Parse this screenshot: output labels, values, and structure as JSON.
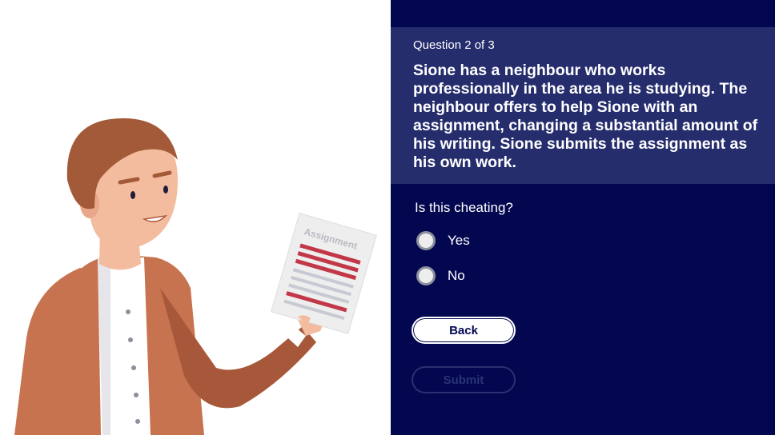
{
  "illustration": {
    "document_label": "Assignment",
    "colors": {
      "skin": "#f3bc9f",
      "hair": "#a25a38",
      "jacket": "#c8734f",
      "shirt": "#ffffff",
      "paper_lines_red": "#c23848",
      "paper_lines_grey": "#c7c9d3"
    }
  },
  "quiz": {
    "counter": "Question 2 of 3",
    "question": "Sione has a neighbour who works professionally in the area he is studying. The neighbour offers to help Sione with an assignment, changing a substantial amount of his writing. Sione submits the assignment as his own work.",
    "prompt": "Is this cheating?",
    "options": [
      {
        "label": "Yes",
        "selected": false
      },
      {
        "label": "No",
        "selected": false
      }
    ],
    "back_label": "Back",
    "submit_label": "Submit",
    "submit_enabled": false
  },
  "colors": {
    "panel_bg": "#020750",
    "question_card_bg": "#262d6d"
  }
}
